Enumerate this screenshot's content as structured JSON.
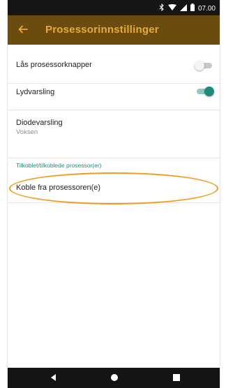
{
  "status_bar": {
    "time": "07.00",
    "icons": [
      "bluetooth-icon",
      "wifi-icon",
      "signal-icon",
      "battery-icon"
    ]
  },
  "app_bar": {
    "title": "Prosessorinnstillinger",
    "back_icon": "arrow-left-icon",
    "background": "#6b4c10",
    "title_color": "#e8a93a"
  },
  "settings": {
    "lock_buttons": {
      "label": "Lås prosessorknapper",
      "enabled": false
    },
    "sound_alert": {
      "label": "Lydvarsling",
      "enabled": true
    },
    "diode_alert": {
      "label": "Diodevarsling",
      "value": "Voksen"
    }
  },
  "section": {
    "connected_header": "Tilkoblet/tilkoblede prosessor(er)",
    "disconnect_label": "Koble fra prosessoren(e)"
  },
  "colors": {
    "accent": "#1d8a7c",
    "highlight_ring": "#f39a1a"
  },
  "nav_bar": {
    "icons": [
      "back-triangle-icon",
      "home-circle-icon",
      "recents-square-icon"
    ]
  }
}
